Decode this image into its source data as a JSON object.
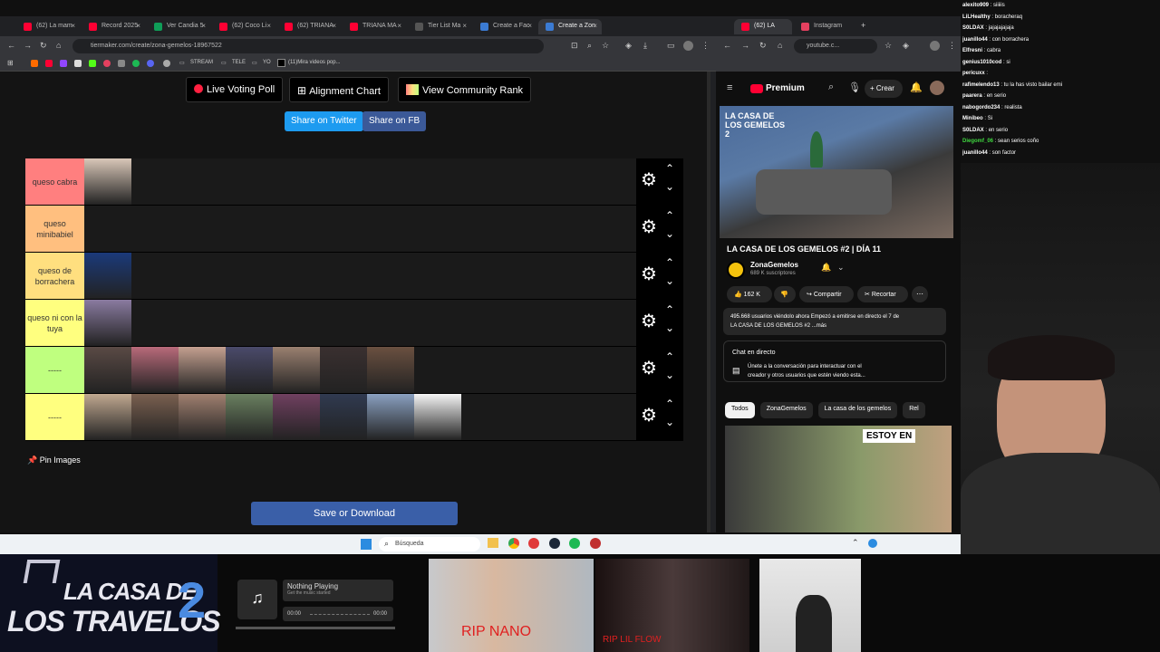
{
  "left_browser": {
    "tabs": [
      {
        "label": "(62) La mam",
        "color": "#ff0033"
      },
      {
        "label": "Record 2025",
        "color": "#ff0033"
      },
      {
        "label": "Ver Candia 5",
        "color": "#0f9d58"
      },
      {
        "label": "(62) Coco Li",
        "color": "#ff0033"
      },
      {
        "label": "(62) TRIANA",
        "color": "#ff0033"
      },
      {
        "label": "TRIANA MA",
        "color": "#ff0033"
      },
      {
        "label": "Tier List Ma",
        "color": "#555555"
      },
      {
        "label": "Create a Fac",
        "color": "#3b7bd3"
      },
      {
        "label": "Create a Zon",
        "color": "#3b7bd3"
      }
    ],
    "url": "tiermaker.com/create/zona-gemelos-18967522",
    "bookmarks": [
      "STREAM",
      "TELE",
      "YO",
      "(11)Mira videos pop..."
    ]
  },
  "tiermaker": {
    "buttons": {
      "poll": "Live Voting Poll",
      "alignment": "Alignment Chart",
      "community": "View Community Rank"
    },
    "share": {
      "twitter": "Share on Twitter",
      "fb": "Share on FB"
    },
    "tiers": [
      {
        "label": "queso cabra",
        "color": "#ff7f7f",
        "images": [
          "#d9c7b8"
        ]
      },
      {
        "label": "queso minibabiel",
        "color": "#ffbf7f",
        "images": []
      },
      {
        "label": "queso de borrachera",
        "color": "#ffdf7f",
        "images": [
          "#1b3a7a"
        ]
      },
      {
        "label": "queso ni con la tuya",
        "color": "#ffff7f",
        "images": [
          "#8a7ba0"
        ]
      },
      {
        "label": "-----",
        "color": "#bfff7f",
        "images": [
          "#5a4a45",
          "#b86a7a",
          "#c4a090",
          "#4a4a6a",
          "#9a8070",
          "#3a3030",
          "#6a5040"
        ]
      },
      {
        "label": "-----",
        "color": "#ffff7f",
        "images": [
          "#c0a890",
          "#7a6050",
          "#a08070",
          "#6a8060",
          "#704060",
          "#303a50",
          "#8aa0c0",
          "#f5f5f5"
        ]
      }
    ],
    "pin": "Pin Images",
    "save": "Save or Download"
  },
  "right_browser": {
    "tabs": [
      "(62) LA",
      "Instagram"
    ],
    "url": "youtube.c...",
    "premium": "Premium",
    "create": "Crear",
    "thumb_caption": "LA CASA DE LOS GEMELOS 2",
    "video_title": "LA CASA DE LOS GEMELOS #2 | DÍA 11",
    "channel": "ZonaGemelos",
    "subs": "689 K suscriptores",
    "likes": "162 K",
    "share": "Compartir",
    "clip": "Recortar",
    "desc1": "495.668 usuarios viéndolo ahora  Empezó a emitirse en directo el 7 de",
    "desc2": "LA CASA DE LOS GEMELOS #2 ...más",
    "chat_title": "Chat en directo",
    "chat_desc1": "Únete a la conversación para interactuar con el",
    "chat_desc2": "creador y otros usuarios que estén viendo esta...",
    "chips": [
      "Todos",
      "ZonaGemelos",
      "La casa de los gemelos",
      "Rel"
    ],
    "rec_caption": "ESTOY EN"
  },
  "chat": [
    {
      "user": "alexito909",
      "msg": "siiiiis",
      "color": "#ffffff"
    },
    {
      "user": "LiLHealthy",
      "msg": "boracheraq",
      "color": "#ffffff"
    },
    {
      "user": "S0LDAX",
      "msg": "jajajajajaja",
      "color": "#ffffff"
    },
    {
      "user": "juanillo44",
      "msg": "con borrachera",
      "color": "#ffffff"
    },
    {
      "user": "Elfresni",
      "msg": "cabra",
      "color": "#ffffff"
    },
    {
      "user": "genius1010cod",
      "msg": "si",
      "color": "#ffffff"
    },
    {
      "user": "pericuxx",
      "msg": "",
      "color": "#ffffff"
    },
    {
      "user": "rafimelendo13",
      "msg": "tu la has visto bailar emi",
      "color": "#ffffff"
    },
    {
      "user": "paarera",
      "msg": "en serio",
      "color": "#ffffff"
    },
    {
      "user": "nabogordo234",
      "msg": "realista",
      "color": "#ffffff"
    },
    {
      "user": "Minibeo",
      "msg": "Si",
      "color": "#ffffff"
    },
    {
      "user": "S0LDAX",
      "msg": "en serio",
      "color": "#ffffff"
    },
    {
      "user": "Diegomf_06",
      "msg": "sean serios coño",
      "color": "#3fd63f"
    },
    {
      "user": "juanillo44",
      "msg": "son factor",
      "color": "#ffffff"
    }
  ],
  "taskbar": {
    "search": "Búsqueda"
  },
  "bottom": {
    "logo1": "LA CASA DE",
    "logo2": "LOS TRAVELOS",
    "logo3": "2",
    "music_title": "Nothing Playing",
    "music_sub": "Get the music started",
    "time_start": "00:00",
    "time_end": "00:00",
    "video1": "RIP NANO",
    "video2": "RIP LIL FLOW"
  }
}
